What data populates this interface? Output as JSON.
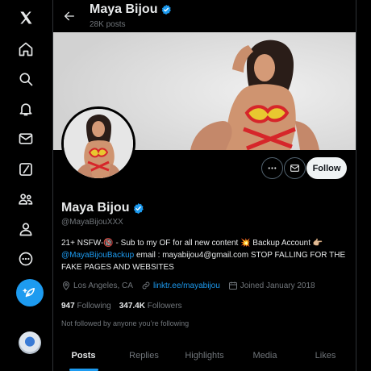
{
  "header": {
    "name": "Maya Bijou",
    "post_count": "28K posts"
  },
  "profile": {
    "display_name": "Maya Bijou",
    "handle": "@MayaBijouXXX",
    "bio_line1": "21+ NSFW-🔞 - Sub to my OF for all new content 💥 Backup Account 👉🏼",
    "bio_mention": "@MayaBijouBackup",
    "bio_line2_rest": " email : mayabijou4@gmail.com STOP FALLING FOR THE FAKE PAGES AND WEBSITES",
    "location": "Los Angeles, CA",
    "website": "linktr.ee/mayabijou",
    "joined": "Joined January 2018",
    "following_count": "947",
    "following_label": "Following",
    "followers_count": "347.4K",
    "followers_label": "Followers",
    "not_followed_text": "Not followed by anyone you’re following"
  },
  "actions": {
    "follow_label": "Follow"
  },
  "tabs": [
    {
      "label": "Posts",
      "active": true
    },
    {
      "label": "Replies",
      "active": false
    },
    {
      "label": "Highlights",
      "active": false
    },
    {
      "label": "Media",
      "active": false
    },
    {
      "label": "Likes",
      "active": false
    }
  ],
  "nav_icons": [
    "x-logo-icon",
    "home-icon",
    "search-icon",
    "notifications-icon",
    "messages-icon",
    "grok-icon",
    "communities-icon",
    "profile-icon",
    "more-icon",
    "compose-icon"
  ],
  "colors": {
    "accent": "#1d9bf0",
    "background": "#000000",
    "text_primary": "#e7e9ea",
    "text_secondary": "#71767b",
    "verified": "#1d9bf0"
  }
}
